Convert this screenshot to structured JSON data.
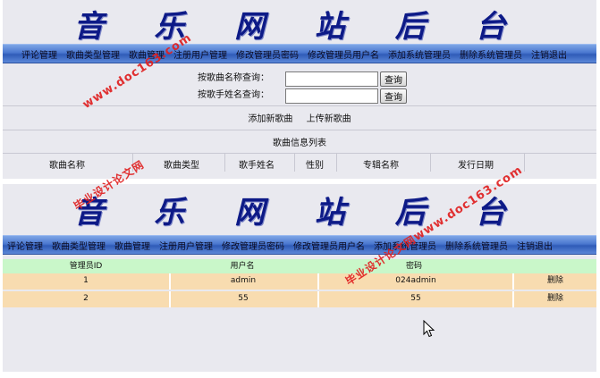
{
  "top_panel": {
    "banner_title": "音 乐 网 站 后 台",
    "nav": [
      "评论管理",
      "歌曲类型管理",
      "歌曲管理",
      "注册用户管理",
      "修改管理员密码",
      "修改管理员用户名",
      "添加系统管理员",
      "删除系统管理员",
      "注销退出"
    ],
    "search_by_name_label": "按歌曲名称查询：",
    "search_by_singer_label": "按歌手姓名查询：",
    "search_button": "查询",
    "add_song_link": "添加新歌曲",
    "upload_song_link": "上传新歌曲",
    "list_title": "歌曲信息列表",
    "columns": [
      "歌曲名称",
      "歌曲类型",
      "歌手姓名",
      "性别",
      "专辑名称",
      "发行日期"
    ]
  },
  "bottom_panel": {
    "banner_title": "音 乐 网 站 后 台",
    "nav": [
      "评论管理",
      "歌曲类型管理",
      "歌曲管理",
      "注册用户管理",
      "修改管理员密码",
      "修改管理员用户名",
      "添加系统管理员",
      "删除系统管理员",
      "注销退出"
    ],
    "columns": [
      "管理员ID",
      "用户名",
      "密码"
    ],
    "rows": [
      {
        "id": "1",
        "username": "admin",
        "password": "024admin",
        "action": "删除"
      },
      {
        "id": "2",
        "username": "55",
        "password": "55",
        "action": "删除"
      }
    ]
  },
  "watermarks": {
    "site": "www.doc163.com",
    "label": "毕业设计论文网"
  },
  "colors": {
    "banner_text": "#0d1a87",
    "nav_bar": "#4a77cf",
    "table_header": "#c9f7c9",
    "table_row": "#f8dcb0",
    "watermark": "#e02020"
  }
}
